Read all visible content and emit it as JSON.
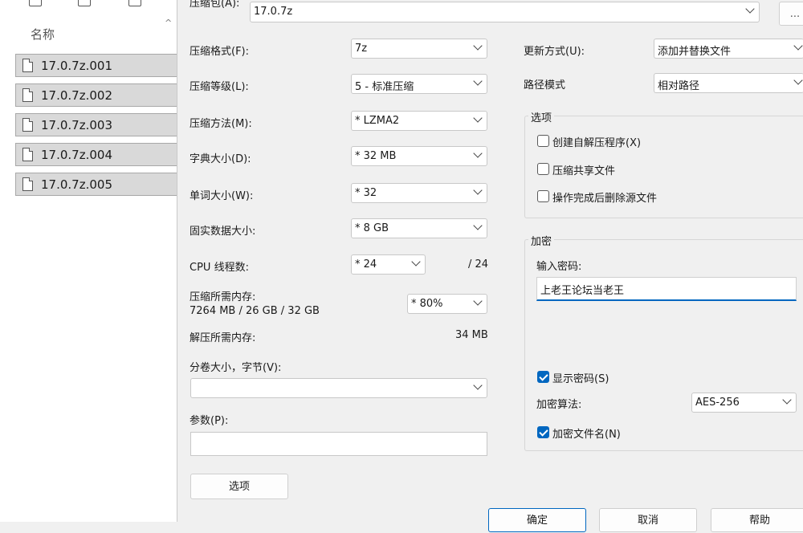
{
  "explorer": {
    "column_name": "名称",
    "files": [
      "17.0.7z.001",
      "17.0.7z.002",
      "17.0.7z.003",
      "17.0.7z.004",
      "17.0.7z.005"
    ]
  },
  "dialog": {
    "archive_label": "压缩包(A):",
    "archive_value": "17.0.7z",
    "browse_label": "...",
    "left": {
      "format_label": "压缩格式(F):",
      "format_value": "7z",
      "level_label": "压缩等级(L):",
      "level_value": "5 - 标准压缩",
      "method_label": "压缩方法(M):",
      "method_value": "* LZMA2",
      "dict_label": "字典大小(D):",
      "dict_value": "* 32 MB",
      "word_label": "单词大小(W):",
      "word_value": "* 32",
      "solid_label": "固实数据大小:",
      "solid_value": "* 8 GB",
      "threads_label": "CPU 线程数:",
      "threads_value": "* 24",
      "threads_max": "/ 24",
      "mem_comp_label": "压缩所需内存:",
      "mem_comp_detail": "7264 MB / 26 GB / 32 GB",
      "mem_comp_value": "* 80%",
      "mem_decomp_label": "解压所需内存:",
      "mem_decomp_value": "34 MB",
      "volume_label": "分卷大小，字节(V):",
      "volume_value": "",
      "params_label": "参数(P):",
      "params_value": "",
      "options_button": "选项"
    },
    "right": {
      "update_label": "更新方式(U):",
      "update_value": "添加并替换文件",
      "path_label": "路径模式",
      "path_value": "相对路径",
      "options_group": "选项",
      "opt_sfx": "创建自解压程序(X)",
      "opt_shared": "压缩共享文件",
      "opt_delete": "操作完成后删除源文件",
      "encrypt_group": "加密",
      "password_label": "输入密码:",
      "password_value": "上老王论坛当老王",
      "show_password": "显示密码(S)",
      "enc_method_label": "加密算法:",
      "enc_method_value": "AES-256",
      "enc_names": "加密文件名(N)"
    },
    "buttons": {
      "ok": "确定",
      "cancel": "取消",
      "help": "帮助"
    }
  }
}
